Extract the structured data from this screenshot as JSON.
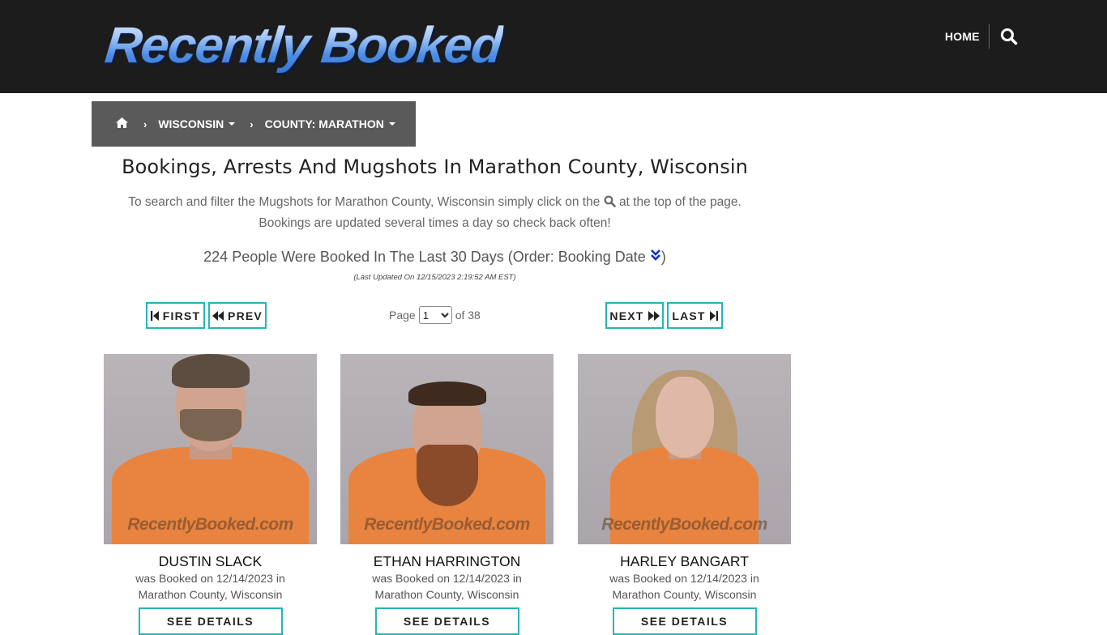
{
  "header": {
    "logo_text": "Recently Booked",
    "nav_home": "HOME"
  },
  "breadcrumb": {
    "state": "WISCONSIN",
    "county": "COUNTY: MARATHON"
  },
  "page": {
    "title": "Bookings, Arrests And Mugshots In Marathon County, Wisconsin",
    "intro_before_icon": "To search and filter the Mugshots for Marathon County, Wisconsin simply click on the",
    "intro_after_icon": "at the top of the page.",
    "intro_line2": "Bookings are updated several times a day so check back often!",
    "count_before": "224 People Were Booked In The Last 30 Days (Order: Booking Date",
    "count_after": ")",
    "updated": "(Last Updated On 12/15/2023 2:19:52 AM EST)"
  },
  "pager": {
    "first": "FIRST",
    "prev": "PREV",
    "next": "NEXT",
    "last": "LAST",
    "page_label": "Page",
    "current_page": "1",
    "of_label": "of 38"
  },
  "bookings": [
    {
      "name": "DUSTIN SLACK",
      "line1": "was Booked on 12/14/2023 in",
      "line2": "Marathon County, Wisconsin",
      "watermark": "RecentlyBooked.com",
      "button": "SEE DETAILS"
    },
    {
      "name": "ETHAN HARRINGTON",
      "line1": "was Booked on 12/14/2023 in",
      "line2": "Marathon County, Wisconsin",
      "watermark": "RecentlyBooked.com",
      "button": "SEE DETAILS"
    },
    {
      "name": "HARLEY BANGART",
      "line1": "was Booked on 12/14/2023 in",
      "line2": "Marathon County, Wisconsin",
      "watermark": "RecentlyBooked.com",
      "button": "SEE DETAILS"
    }
  ],
  "colors": {
    "header_bg": "#1c1c1c",
    "breadcrumb_bg": "#5a5a5a",
    "accent_teal": "#26b5b5",
    "order_icon_blue": "#0a2fd0"
  }
}
